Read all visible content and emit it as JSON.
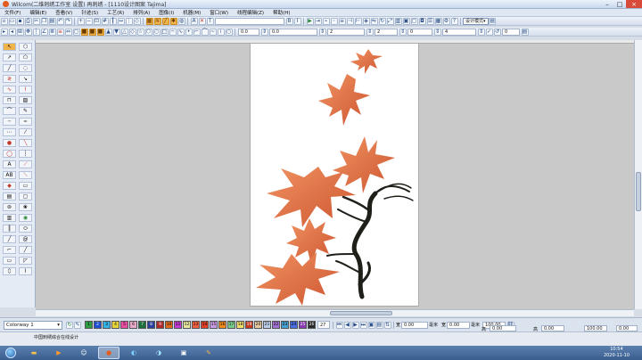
{
  "window": {
    "title": "Wilcom(二维刺绣工作室 设置) 再刺绣 - [1110设计图案      Tajima]"
  },
  "menu": [
    "文件(F)",
    "编辑(E)",
    "查看(V)",
    "针迹(S)",
    "工艺(R)",
    "排列(A)",
    "图像(I)",
    "机器(M)",
    "窗口(W)",
    "线程编辑(Z)",
    "帮助(H)"
  ],
  "toolbar1": {
    "mode_label": "设计模式"
  },
  "toolbar2": {
    "field_a": "0.0",
    "field_b": "0.0",
    "field_c": "2",
    "field_d": "2",
    "field_e": "4",
    "field_f": "0"
  },
  "colorway": {
    "label": "Colorway 1",
    "count": "27"
  },
  "palette": [
    {
      "n": "1",
      "c": "#2d9c45"
    },
    {
      "n": "2",
      "c": "#1f4fd0"
    },
    {
      "n": "3",
      "c": "#35b0e0"
    },
    {
      "n": "4",
      "c": "#e6d33a"
    },
    {
      "n": "5",
      "c": "#e84fa3"
    },
    {
      "n": "6",
      "c": "#e8a9c9"
    },
    {
      "n": "7",
      "c": "#1c6e3a"
    },
    {
      "n": "8",
      "c": "#2a3f99"
    },
    {
      "n": "9",
      "c": "#b02a2a"
    },
    {
      "n": "10",
      "c": "#e06a1e"
    },
    {
      "n": "11",
      "c": "#c23ad0"
    },
    {
      "n": "12",
      "c": "#e7e7a0"
    },
    {
      "n": "13",
      "c": "#f06040"
    },
    {
      "n": "14",
      "c": "#e0402a"
    },
    {
      "n": "15",
      "c": "#c99be0"
    },
    {
      "n": "16",
      "c": "#f28a20"
    },
    {
      "n": "17",
      "c": "#7acb8a"
    },
    {
      "n": "18",
      "c": "#f4e06a"
    },
    {
      "n": "19",
      "c": "#c23b20"
    },
    {
      "n": "20",
      "c": "#e6c9a0"
    },
    {
      "n": "21",
      "c": "#b9cde8"
    },
    {
      "n": "22",
      "c": "#a070d0"
    },
    {
      "n": "23",
      "c": "#46a0d0"
    },
    {
      "n": "24",
      "c": "#4a6ee0"
    },
    {
      "n": "25",
      "c": "#8a3cb0"
    },
    {
      "n": "26",
      "c": "#2b2b2b"
    }
  ],
  "status": {
    "hint": "中国刺绣综合在线设计",
    "x_label": "宽",
    "y_label": "高",
    "x": "0.00",
    "y": "0.00",
    "w_label": "宽",
    "h_label": "高",
    "w": "0.00",
    "h": "0.00",
    "pct_w": "100.00",
    "pct_h": "100.00",
    "deg": "0.00",
    "unit": "毫米"
  },
  "clock": {
    "time": "10:54",
    "date": "2020-11-10"
  }
}
